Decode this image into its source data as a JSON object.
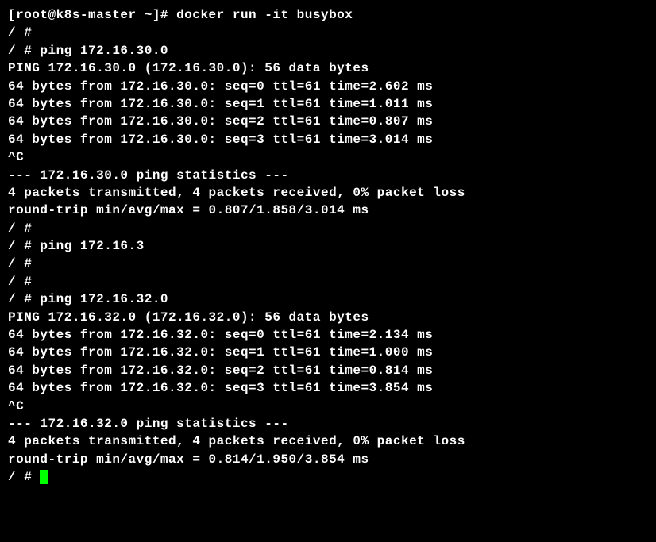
{
  "prompt_host": "[root@k8s-master ~]# ",
  "cmd_docker": "docker run -it busybox",
  "shell_prompt": "/ # ",
  "cmd_ping1": "ping 172.16.30.0",
  "ping1_header": "PING 172.16.30.0 (172.16.30.0): 56 data bytes",
  "ping1_replies": [
    "64 bytes from 172.16.30.0: seq=0 ttl=61 time=2.602 ms",
    "64 bytes from 172.16.30.0: seq=1 ttl=61 time=1.011 ms",
    "64 bytes from 172.16.30.0: seq=2 ttl=61 time=0.807 ms",
    "64 bytes from 172.16.30.0: seq=3 ttl=61 time=3.014 ms"
  ],
  "ctrl_c": "^C",
  "ping1_stats_header": "--- 172.16.30.0 ping statistics ---",
  "ping1_stats_packets": "4 packets transmitted, 4 packets received, 0% packet loss",
  "ping1_stats_rtt": "round-trip min/avg/max = 0.807/1.858/3.014 ms",
  "cmd_ping_partial": "ping 172.16.3",
  "cmd_ping2": "ping 172.16.32.0",
  "ping2_header": "PING 172.16.32.0 (172.16.32.0): 56 data bytes",
  "ping2_replies": [
    "64 bytes from 172.16.32.0: seq=0 ttl=61 time=2.134 ms",
    "64 bytes from 172.16.32.0: seq=1 ttl=61 time=1.000 ms",
    "64 bytes from 172.16.32.0: seq=2 ttl=61 time=0.814 ms",
    "64 bytes from 172.16.32.0: seq=3 ttl=61 time=3.854 ms"
  ],
  "ping2_stats_header": "--- 172.16.32.0 ping statistics ---",
  "ping2_stats_packets": "4 packets transmitted, 4 packets received, 0% packet loss",
  "ping2_stats_rtt": "round-trip min/avg/max = 0.814/1.950/3.854 ms"
}
